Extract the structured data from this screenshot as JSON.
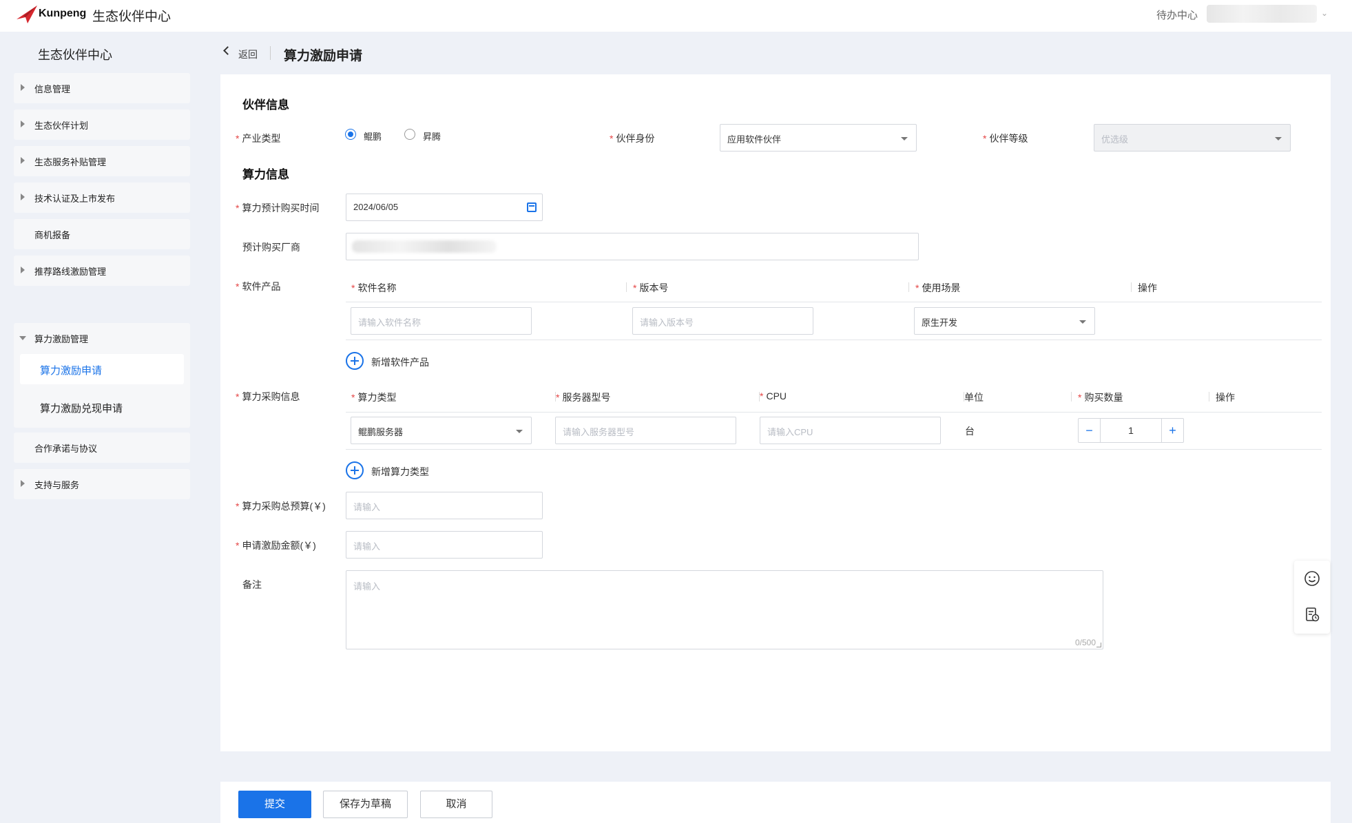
{
  "header": {
    "brand": "Kunpeng",
    "app_title": "生态伙伴中心",
    "todo_label": "待办中心"
  },
  "sidebar": {
    "title": "生态伙伴中心",
    "items": [
      {
        "label": "信息管理"
      },
      {
        "label": "生态伙伴计划"
      },
      {
        "label": "生态服务补贴管理"
      },
      {
        "label": "技术认证及上市发布"
      },
      {
        "label": "商机报备"
      },
      {
        "label": "推荐路线激励管理"
      },
      {
        "label": "算力激励管理"
      },
      {
        "label": "合作承诺与协议"
      },
      {
        "label": "支持与服务"
      }
    ],
    "sub_items": [
      {
        "label": "算力激励申请"
      },
      {
        "label": "算力激励兑现申请"
      }
    ]
  },
  "page": {
    "back_label": "返回",
    "title": "算力激励申请"
  },
  "partner_section": {
    "title": "伙伴信息",
    "industry_label": "产业类型",
    "industry_options": [
      "鲲鹏",
      "昇腾"
    ],
    "industry_selected": "鲲鹏",
    "identity_label": "伙伴身份",
    "identity_value": "应用软件伙伴",
    "level_label": "伙伴等级",
    "level_value": "优选级"
  },
  "compute_section": {
    "title": "算力信息",
    "purchase_time_label": "算力预计购买时间",
    "purchase_time_value": "2024/06/05",
    "vendor_label": "预计购买厂商",
    "software_label": "软件产品",
    "software_columns": [
      "软件名称",
      "版本号",
      "使用场景",
      "操作"
    ],
    "software_row": {
      "name_placeholder": "请输入软件名称",
      "version_placeholder": "请输入版本号",
      "scene_value": "原生开发"
    },
    "add_software_label": "新增软件产品",
    "purchase_label": "算力采购信息",
    "purchase_columns": [
      "算力类型",
      "服务器型号",
      "CPU",
      "单位",
      "购买数量",
      "操作"
    ],
    "purchase_row": {
      "type_value": "鲲鹏服务器",
      "model_placeholder": "请输入服务器型号",
      "cpu_placeholder": "请输入CPU",
      "unit": "台",
      "quantity": "1"
    },
    "add_compute_label": "新增算力类型",
    "budget_label": "算力采购总预算(￥)",
    "budget_placeholder": "请输入",
    "incentive_label": "申请激励金额(￥)",
    "incentive_placeholder": "请输入",
    "remark_label": "备注",
    "remark_placeholder": "请输入",
    "remark_count": "0/500"
  },
  "footer": {
    "submit_label": "提交",
    "draft_label": "保存为草稿",
    "cancel_label": "取消"
  },
  "icons": {
    "smiley": "smiley-icon",
    "feedback": "clipboard-clock-icon"
  },
  "colors": {
    "accent": "#1a73e8",
    "required": "#e54545",
    "brand_red": "#d7282f"
  }
}
